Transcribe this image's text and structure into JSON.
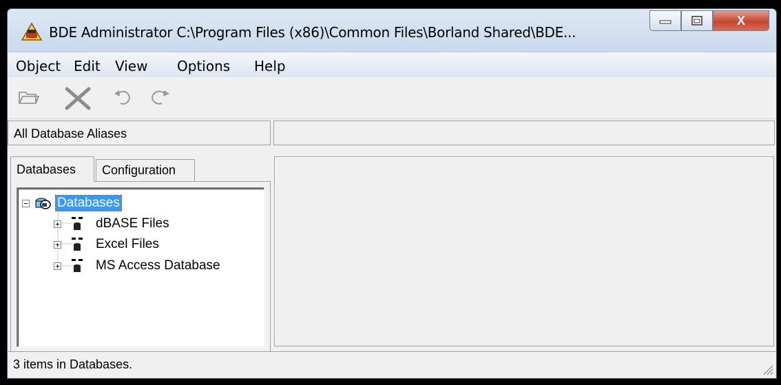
{
  "window": {
    "title": "BDE Administrator  C:\\Program Files (x86)\\Common Files\\Borland Shared\\BDE...",
    "icon": "bde-app-icon"
  },
  "caption_buttons": {
    "minimize_icon": "minimize-icon",
    "maximize_icon": "maximize-icon",
    "close_label": "X"
  },
  "menu": [
    {
      "label": "Object"
    },
    {
      "label": "Edit"
    },
    {
      "label": "View"
    },
    {
      "label": "Options"
    },
    {
      "label": "Help"
    }
  ],
  "toolbar": [
    "open-icon",
    "delete-icon",
    "undo-icon",
    "redo-icon"
  ],
  "left_header": "All Database Aliases",
  "right_header": "",
  "tabs": [
    {
      "label": "Databases",
      "active": true
    },
    {
      "label": "Configuration",
      "active": false
    }
  ],
  "tree": {
    "root": {
      "label": "Databases",
      "expanded": true,
      "selected": true
    },
    "children": [
      {
        "label": "dBASE Files",
        "expanded": false
      },
      {
        "label": "Excel Files",
        "expanded": false
      },
      {
        "label": "MS Access Database",
        "expanded": false
      }
    ]
  },
  "status": "3 items in Databases.",
  "colors": {
    "selection": "#3399ff",
    "window_bg": "#f0f0f0",
    "close_button": "#c6462f"
  }
}
